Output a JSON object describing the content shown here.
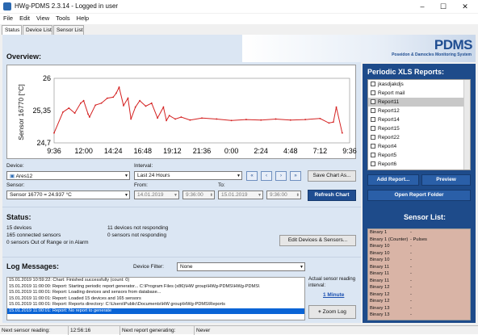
{
  "window": {
    "title": "HWg-PDMS 2.3.14 - Logged in user",
    "min": "–",
    "max": "☐",
    "close": "✕"
  },
  "menu": [
    "File",
    "Edit",
    "View",
    "Tools",
    "Help"
  ],
  "tabs": [
    "Status",
    "Device List",
    "Sensor List"
  ],
  "logo": {
    "name": "PDMS",
    "subtitle": "Poseidon & Damocles Monitoring System"
  },
  "overview": {
    "title": "Overview:"
  },
  "chart_data": {
    "type": "line",
    "ylabel": "Sensor 16770 [°C]",
    "yticks": [
      "26",
      "25,35",
      "24,7"
    ],
    "ylim": [
      24.7,
      26
    ],
    "xticks": [
      "9:36",
      "12:00",
      "14:24",
      "16:48",
      "19:12",
      "21:36",
      "0:00",
      "2:24",
      "4:48",
      "7:12",
      "9:36"
    ],
    "color": "#d42020",
    "series": [
      {
        "x": [
          0,
          0.3,
          0.5,
          0.7,
          0.9,
          1.0,
          1.15,
          1.2,
          1.4,
          1.6,
          1.8,
          2.0,
          2.1,
          2.2,
          2.35,
          2.5,
          2.6,
          2.75,
          2.9,
          3.1,
          3.3,
          3.5,
          3.7,
          3.8,
          3.9,
          4.1,
          4.3,
          4.6,
          5.0,
          5.5,
          6.0,
          6.5,
          7.0,
          7.5,
          8.0,
          8.5,
          9.0,
          9.3,
          9.45,
          9.55,
          9.75
        ],
        "y": [
          24.9,
          25.32,
          25.4,
          25.3,
          25.5,
          25.55,
          25.28,
          25.22,
          25.46,
          25.5,
          25.6,
          25.62,
          25.7,
          25.82,
          25.45,
          25.6,
          25.18,
          25.42,
          25.55,
          25.44,
          25.5,
          25.2,
          25.42,
          25.15,
          25.25,
          25.18,
          25.22,
          25.16,
          25.2,
          25.18,
          25.15,
          25.17,
          25.16,
          25.18,
          25.16,
          25.17,
          25.19,
          25.1,
          25.12,
          25.42,
          24.9
        ]
      }
    ]
  },
  "controls": {
    "device_label": "Device:",
    "device_value": "Ares12",
    "interval_label": "Interval:",
    "interval_value": "Last 24 Hours",
    "sensor_label": "Sensor:",
    "sensor_value": "Sensor 16770 = 24.937 °C",
    "from_label": "From:",
    "from_date": "14.01.2019",
    "from_time": "9:36:00",
    "to_label": "To:",
    "to_date": "15.01.2019",
    "to_time": "9:36:00",
    "nav": [
      "«",
      "‹",
      "›",
      "»"
    ],
    "save_chart": "Save Chart As...",
    "refresh_chart": "Refresh Chart"
  },
  "status": {
    "title": "Status:",
    "devices": "15 devices",
    "connected": "165 connected sensors",
    "out_of_range": "0 sensors Out of Range or in Alarm",
    "devices_not_responding": "11 devices not responding",
    "sensors_not_responding": "0 sensors not responding",
    "edit_button": "Edit Devices & Sensors..."
  },
  "log": {
    "title": "Log Messages:",
    "filter_label": "Device Filter:",
    "filter_value": "None",
    "lines": [
      "15.01.2019 10:59:22: Chart: Finished successfully (count: 0)",
      "15.01.2019 11:00:00: Report: Starting periodic report generator... C:\\Program Files (x86)\\HW group\\HWg-PDMS\\HWg-PDMS\\",
      "15.01.2019 11:00:01: Report: Loading devices and sensors from database...",
      "15.01.2019 11:00:01: Report: Loaded 15 devices and 165 sensors",
      "15.01.2019 11:00:01: Report: Reports directory: C:\\Users\\Public\\Documents\\HW group\\HWg-PDMS\\Reports",
      "15.01.2019 11:00:01: Report: No report to generate"
    ],
    "interval_label": "Actual sensor reading interval:",
    "interval_value": "1 Minute",
    "zoom_button": "Zoom Log"
  },
  "reports": {
    "title": "Periodic XLS Reports:",
    "items": [
      "jkasdjakdjs",
      "Report mail",
      "Report11",
      "Report12",
      "Report14",
      "Report15",
      "Report22",
      "Report4",
      "Report5",
      "Report6"
    ],
    "add_button": "Add Report...",
    "preview_button": "Preview",
    "open_folder_button": "Open Report Folder"
  },
  "sensors": {
    "title": "Sensor List:",
    "items": [
      {
        "name": "Binary 1",
        "value": "-"
      },
      {
        "name": "Binary 1 (Counter)",
        "value": "- Pulses"
      },
      {
        "name": "Binary 10",
        "value": "-"
      },
      {
        "name": "Binary 10",
        "value": "-"
      },
      {
        "name": "Binary 10",
        "value": "-"
      },
      {
        "name": "Binary 11",
        "value": "-"
      },
      {
        "name": "Binary 11",
        "value": "-"
      },
      {
        "name": "Binary 11",
        "value": "-"
      },
      {
        "name": "Binary 12",
        "value": "-"
      },
      {
        "name": "Binary 12",
        "value": "-"
      },
      {
        "name": "Binary 12",
        "value": "-"
      },
      {
        "name": "Binary 13",
        "value": "-"
      },
      {
        "name": "Binary 13",
        "value": "-"
      }
    ]
  },
  "statusbar": {
    "next_reading_label": "Next sensor reading:",
    "next_reading_value": "12:56:16",
    "next_report_label": "Next report generating:",
    "next_report_value": "Never"
  }
}
